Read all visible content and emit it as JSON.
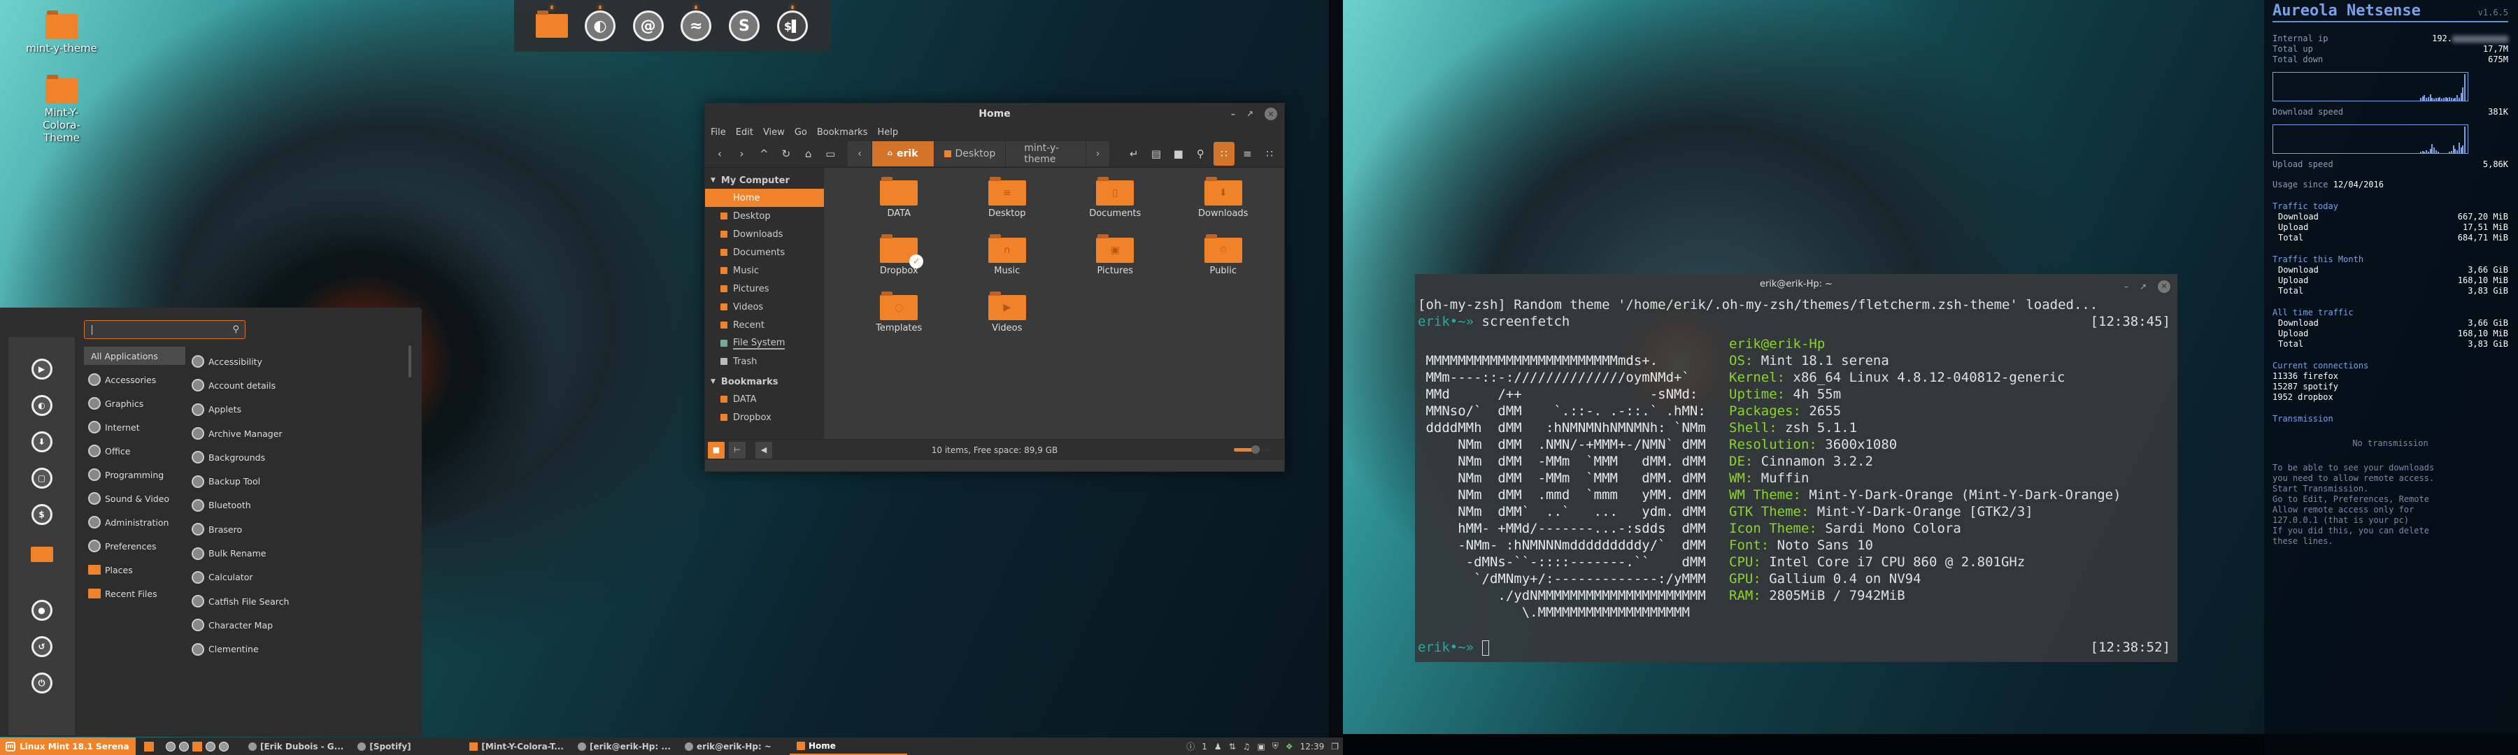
{
  "desktop": {
    "icons": [
      {
        "label": "mint-y-theme"
      },
      {
        "label": "Mint-Y-Colora-Theme"
      }
    ]
  },
  "dock": {
    "items": [
      {
        "name": "files",
        "icon": "folder-icon",
        "running": true
      },
      {
        "name": "firefox",
        "icon": "firefox-icon",
        "glyph": "◐",
        "running": true
      },
      {
        "name": "mail",
        "icon": "at-sign-icon",
        "glyph": "@",
        "running": false
      },
      {
        "name": "spotify",
        "icon": "spotify-icon",
        "glyph": "≈",
        "running": true
      },
      {
        "name": "skype",
        "icon": "skype-icon",
        "glyph": "S",
        "running": false
      },
      {
        "name": "terminal",
        "icon": "terminal-icon",
        "glyph": "$▌",
        "running": true
      }
    ]
  },
  "file_manager": {
    "title": "Home",
    "menu": [
      "File",
      "Edit",
      "View",
      "Go",
      "Bookmarks",
      "Help"
    ],
    "breadcrumbs": [
      "erik",
      "Desktop",
      "mint-y-theme"
    ],
    "sidebar": {
      "sections": [
        {
          "title": "My Computer",
          "items": [
            "Home",
            "Desktop",
            "Downloads",
            "Documents",
            "Music",
            "Pictures",
            "Videos",
            "Recent",
            "File System",
            "Trash"
          ]
        },
        {
          "title": "Bookmarks",
          "items": [
            "DATA",
            "Dropbox"
          ]
        }
      ],
      "active": "Home"
    },
    "items": [
      {
        "name": "DATA",
        "glyph": ""
      },
      {
        "name": "Desktop",
        "glyph": "≡"
      },
      {
        "name": "Documents",
        "glyph": "▯"
      },
      {
        "name": "Downloads",
        "glyph": "⬇"
      },
      {
        "name": "Dropbox",
        "glyph": "",
        "synced": true
      },
      {
        "name": "Music",
        "glyph": "∩"
      },
      {
        "name": "Pictures",
        "glyph": "▣"
      },
      {
        "name": "Public",
        "glyph": "♲"
      },
      {
        "name": "Templates",
        "glyph": "◌"
      },
      {
        "name": "Videos",
        "glyph": "▶"
      }
    ],
    "status": "10 items, Free space: 89,9 GB",
    "zoom_level": 0.6
  },
  "start_menu": {
    "search": {
      "value": "",
      "placeholder": ""
    },
    "categories": [
      "All Applications",
      "Accessories",
      "Graphics",
      "Internet",
      "Office",
      "Programming",
      "Sound & Video",
      "Administration",
      "Preferences",
      "Places",
      "Recent Files"
    ],
    "selected_category": "All Applications",
    "apps": [
      "Accessibility",
      "Account details",
      "Applets",
      "Archive Manager",
      "Backgrounds",
      "Backup Tool",
      "Bluetooth",
      "Brasero",
      "Bulk Rename",
      "Calculator",
      "Catfish File Search",
      "Character Map",
      "Clementine"
    ],
    "favorites": [
      "transmission-icon",
      "firefox-icon",
      "download-icon",
      "screen-icon",
      "terminal-icon",
      "folder-icon",
      "lock-icon",
      "logout-icon",
      "power-icon"
    ]
  },
  "panel": {
    "menu_label": "Linux Mint 18.1 Serena",
    "tasks": [
      {
        "label": "[Erik Dubois - G...",
        "icon": "firefox"
      },
      {
        "label": "[Spotify]",
        "icon": "spotify"
      },
      {
        "label": "[Mint-Y-Colora-T...",
        "icon": "folder"
      },
      {
        "label": "[erik@erik-Hp: ...",
        "icon": "terminal"
      },
      {
        "label": "erik@erik-Hp: ~",
        "icon": "terminal"
      },
      {
        "label": "Home",
        "icon": "folder",
        "active": true
      }
    ],
    "tray": {
      "notifications": "1",
      "clock": "12:39"
    }
  },
  "terminal": {
    "title": "erik@erik-Hp: ~",
    "lines": {
      "banner": "[oh-my-zsh] Random theme '/home/erik/.oh-my-zsh/themes/fletcherm.zsh-theme' loaded...",
      "prompt_user": "erik",
      "prompt_sep": "•~»",
      "command": "screenfetch",
      "ts1": "[12:38:45]",
      "ts2": "[12:38:52]"
    },
    "art": [
      "",
      " MMMMMMMMMMMMMMMMMMMMMMMMmds+.",
      " MMm----::-://////////////oymNMd+`",
      " MMd      /++                -sNMd:",
      " MMNso/`  dMM    `.::-. .-::.` .hMN:",
      " ddddMMh  dMM   :hNMNMNhNMNMNh: `NMm",
      "     NMm  dMM  .NMN/-+MMM+-/NMN` dMM",
      "     NMm  dMM  -MMm  `MMM   dMM. dMM",
      "     NMm  dMM  -MMm  `MMM   dMM. dMM",
      "     NMm  dMM  .mmd  `mmm   yMM. dMM",
      "     NMm  dMM`  ..`   ...   ydm. dMM",
      "     hMM- +MMd/-------...-:sdds  dMM",
      "     -NMm- :hNMNNNmdddddddddy/`  dMM",
      "      -dMNs-``-::::-------.``    dMM",
      "       `/dMNmy+/:-------------:/yMMM",
      "          ./ydNMMMMMMMMMMMMMMMMMMMMM",
      "             \\.MMMMMMMMMMMMMMMMMMM"
    ],
    "userhost": "erik@erik-Hp",
    "info": [
      {
        "k": "OS:",
        "v": "Mint 18.1 serena"
      },
      {
        "k": "Kernel:",
        "v": "x86_64 Linux 4.8.12-040812-generic"
      },
      {
        "k": "Uptime:",
        "v": "4h 55m"
      },
      {
        "k": "Packages:",
        "v": "2655"
      },
      {
        "k": "Shell:",
        "v": "zsh 5.1.1"
      },
      {
        "k": "Resolution:",
        "v": "3600x1080"
      },
      {
        "k": "DE:",
        "v": "Cinnamon 3.2.2"
      },
      {
        "k": "WM:",
        "v": "Muffin"
      },
      {
        "k": "WM Theme:",
        "v": "Mint-Y-Dark-Orange (Mint-Y-Dark-Orange)"
      },
      {
        "k": "GTK Theme:",
        "v": "Mint-Y-Dark-Orange [GTK2/3]"
      },
      {
        "k": "Icon Theme:",
        "v": "Sardi Mono Colora"
      },
      {
        "k": "Font:",
        "v": "Noto Sans 10"
      },
      {
        "k": "CPU:",
        "v": "Intel Core i7 CPU 860 @ 2.801GHz"
      },
      {
        "k": "GPU:",
        "v": "Gallium 0.4 on NV94"
      },
      {
        "k": "RAM:",
        "v": "2805MiB / 7942MiB"
      }
    ]
  },
  "conky": {
    "title": "Aureola Netsense",
    "version": "v1.6.5",
    "internal_ip_label": "Internal ip",
    "internal_ip": "192.",
    "total_up_label": "Total up",
    "total_up": "17,7M",
    "total_down_label": "Total down",
    "total_down": "675M",
    "download_speed_label": "Download speed",
    "download_speed": "381K",
    "upload_speed_label": "Upload speed",
    "upload_speed": "5,86K",
    "usage_since_label": "Usage since",
    "usage_since": "12/04/2016",
    "download_graph": [
      0,
      0,
      0,
      0,
      0,
      0,
      0,
      0,
      0,
      0,
      0,
      0,
      0,
      0,
      0,
      0,
      0,
      0,
      0,
      0,
      0,
      0,
      0,
      0,
      0,
      0,
      0,
      0,
      0,
      0,
      0,
      0,
      0,
      0,
      0,
      0,
      0,
      0,
      0,
      0,
      0,
      0,
      0,
      0,
      0,
      0,
      0,
      0,
      0,
      0,
      0,
      0,
      0,
      0,
      0,
      0,
      0,
      0,
      0,
      0,
      0,
      0,
      0,
      0,
      0,
      0,
      0,
      0,
      0,
      0,
      0,
      0,
      0,
      0,
      0,
      0,
      0.1,
      0.15,
      0.2,
      0.1,
      0.12,
      0.25,
      0.1,
      0.08,
      0.1,
      0.1,
      0.12,
      0.08,
      0.1,
      0.14,
      0.1,
      0.12,
      0.1,
      0.08,
      0.1,
      0.2,
      0.1,
      0.3,
      0.5,
      1.0
    ],
    "upload_graph": [
      0,
      0,
      0,
      0,
      0,
      0,
      0,
      0,
      0,
      0,
      0,
      0,
      0,
      0,
      0,
      0,
      0,
      0,
      0,
      0,
      0,
      0,
      0,
      0,
      0,
      0,
      0,
      0,
      0,
      0,
      0,
      0,
      0,
      0,
      0,
      0,
      0,
      0,
      0,
      0,
      0,
      0,
      0,
      0,
      0,
      0,
      0,
      0,
      0,
      0,
      0,
      0,
      0,
      0,
      0,
      0,
      0,
      0,
      0,
      0,
      0,
      0,
      0,
      0,
      0,
      0,
      0,
      0,
      0,
      0,
      0,
      0,
      0,
      0,
      0,
      0,
      0.05,
      0.08,
      0.05,
      0.1,
      0.05,
      0.15,
      0.35,
      0.2,
      0.1,
      0.05,
      0,
      0,
      0,
      0,
      0,
      0.05,
      0.08,
      0.3,
      0.15,
      0.1,
      0.4,
      0.2,
      0.3,
      1.0
    ],
    "sections": [
      {
        "title": "Traffic today",
        "rows": [
          [
            "Download",
            "667,20 MiB"
          ],
          [
            "Upload",
            "17,51 MiB"
          ],
          [
            "Total",
            "684,71 MiB"
          ]
        ]
      },
      {
        "title": "Traffic this Month",
        "rows": [
          [
            "Download",
            "3,66 GiB"
          ],
          [
            "Upload",
            "168,10 MiB"
          ],
          [
            "Total",
            "3,83 GiB"
          ]
        ]
      },
      {
        "title": "All time traffic",
        "rows": [
          [
            "Download",
            "3,66 GiB"
          ],
          [
            "Upload",
            "168,10 MiB"
          ],
          [
            "Total",
            "3,83 GiB"
          ]
        ]
      }
    ],
    "connections_title": "Current connections",
    "connections": [
      [
        "11336",
        "firefox"
      ],
      [
        "15287",
        "spotify"
      ],
      [
        "1952",
        "dropbox"
      ]
    ],
    "transmission_title": "Transmission",
    "transmission_status": "No transmission",
    "transmission_help": [
      "To be able to see your downloads",
      "you need to allow remote access.",
      "Start Transmission.",
      "Go to Edit, Preferences, Remote",
      "Allow remote access only for",
      "127.0.0.1 (that is your pc)",
      "If you did this, you can delete",
      "these lines."
    ]
  }
}
